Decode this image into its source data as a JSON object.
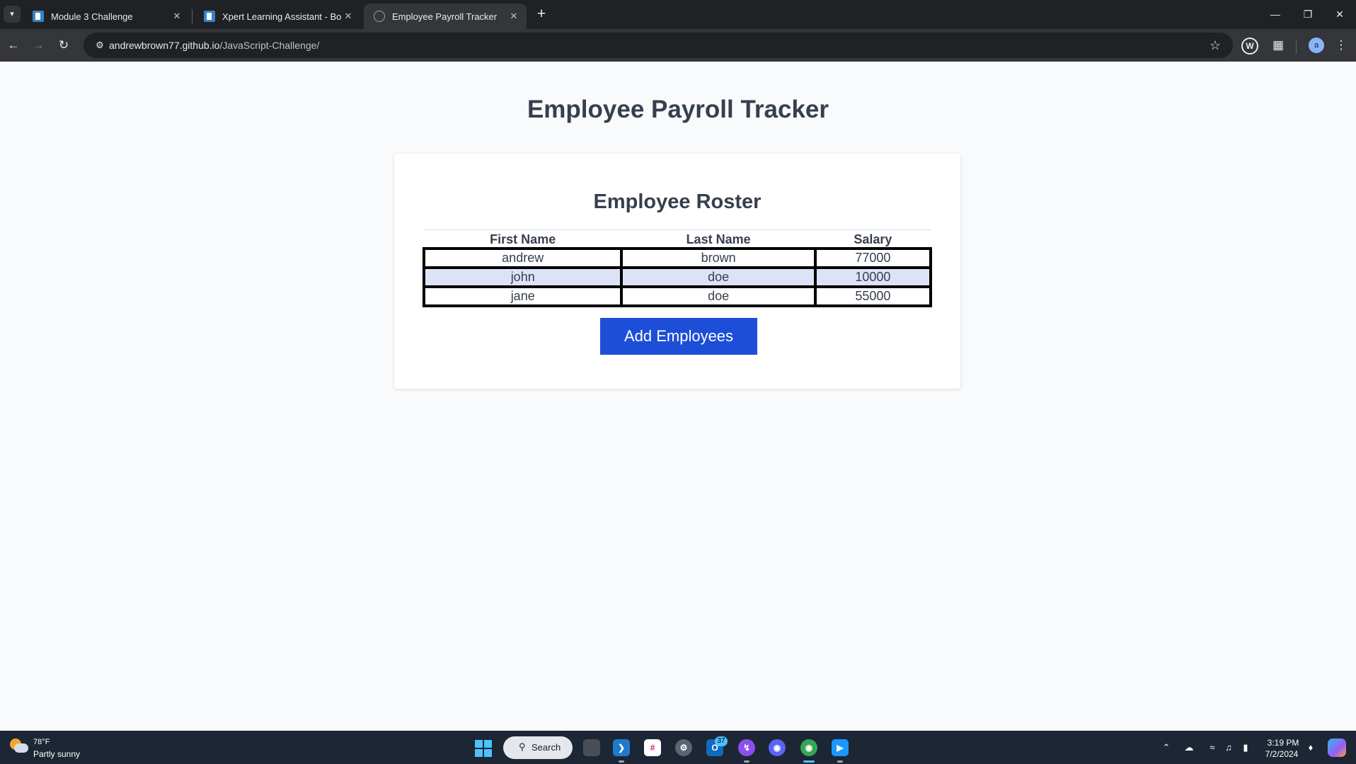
{
  "browser": {
    "tabs": [
      {
        "title": "Module 3 Challenge",
        "favicon": "doc-icon",
        "active": false
      },
      {
        "title": "Xpert Learning Assistant - Boot",
        "favicon": "doc-icon",
        "active": false
      },
      {
        "title": "Employee Payroll Tracker",
        "favicon": "globe-icon",
        "active": true
      }
    ],
    "url_host": "andrewbrown77.github.io",
    "url_path": "/JavaScript-Challenge/",
    "profile_initial": "a"
  },
  "page": {
    "title": "Employee Payroll Tracker",
    "roster_title": "Employee Roster",
    "columns": [
      "First Name",
      "Last Name",
      "Salary"
    ],
    "rows": [
      {
        "first": "andrew",
        "last": "brown",
        "salary": "77000"
      },
      {
        "first": "john",
        "last": "doe",
        "salary": "10000"
      },
      {
        "first": "jane",
        "last": "doe",
        "salary": "55000"
      }
    ],
    "add_button_label": "Add Employees",
    "accent_color": "#1d4ed8",
    "selected_row_color": "#dde3f7"
  },
  "taskbar": {
    "weather_temp": "78°F",
    "weather_desc": "Partly sunny",
    "search_label": "Search",
    "outlook_badge": "37",
    "time": "3:19 PM",
    "date": "7/2/2024"
  }
}
